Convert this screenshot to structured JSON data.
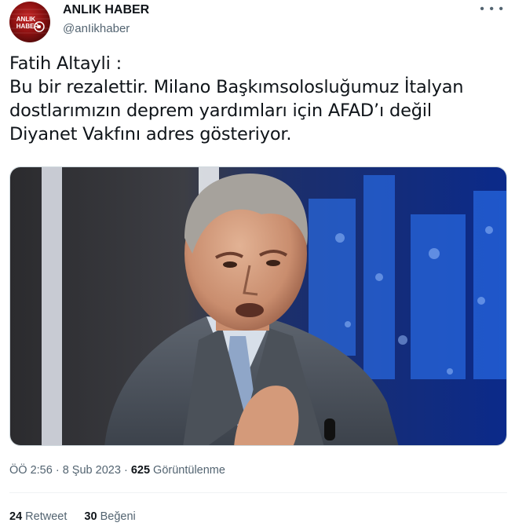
{
  "author": {
    "display_name": "ANLIK HABER",
    "handle": "@anIikhaber",
    "avatar_text_line1": "ANLIK",
    "avatar_text_line2": "HABER"
  },
  "more_icon": "more-horizontal-icon",
  "tweet": {
    "text": "Fatih Altayli :\nBu bir rezalettir. Milano Başkımsolosluğumuz İtalyan dostlarımızın deprem yardımları için AFAD’ı değil Diyanet Vakfını adres gösteriyor."
  },
  "meta": {
    "time": "ÖÖ 2:56",
    "sep1": "·",
    "date": "8 Şub 2023",
    "sep2": "·",
    "views_count": "625",
    "views_label": "Görüntülenme"
  },
  "stats": {
    "retweets_count": "24",
    "retweets_label": "Retweet",
    "likes_count": "30",
    "likes_label": "Beğeni"
  },
  "colors": {
    "text_primary": "#0f1419",
    "text_secondary": "#536471",
    "divider": "#eff3f4",
    "avatar_red": "#c62828"
  }
}
